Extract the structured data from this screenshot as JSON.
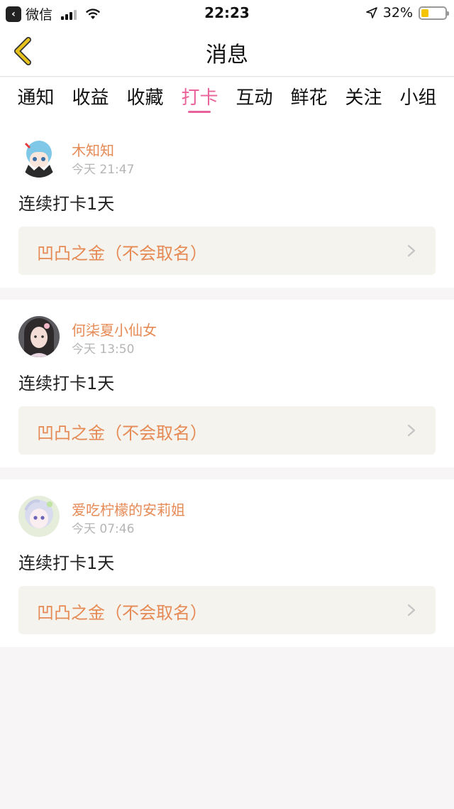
{
  "status_bar": {
    "back_app": "微信",
    "time": "22:23",
    "battery_percent": "32%",
    "battery_level": 0.32
  },
  "nav": {
    "title": "消息"
  },
  "tabs": [
    {
      "label": "通知"
    },
    {
      "label": "收益"
    },
    {
      "label": "收藏"
    },
    {
      "label": "打卡"
    },
    {
      "label": "互动"
    },
    {
      "label": "鲜花"
    },
    {
      "label": "关注"
    },
    {
      "label": "小组"
    }
  ],
  "active_tab": "打卡",
  "items": [
    {
      "username": "木知知",
      "time": "今天 21:47",
      "content": "连续打卡1天",
      "group": "凹凸之金（不会取名）"
    },
    {
      "username": "何柒夏小仙女",
      "time": "今天 13:50",
      "content": "连续打卡1天",
      "group": "凹凸之金（不会取名）"
    },
    {
      "username": "爱吃柠檬的安莉姐",
      "time": "今天 07:46",
      "content": "连续打卡1天",
      "group": "凹凸之金（不会取名）"
    }
  ],
  "colors": {
    "accent_pink": "#e8639a",
    "username_orange": "#e68a55",
    "back_arrow": "#e6c21a"
  }
}
